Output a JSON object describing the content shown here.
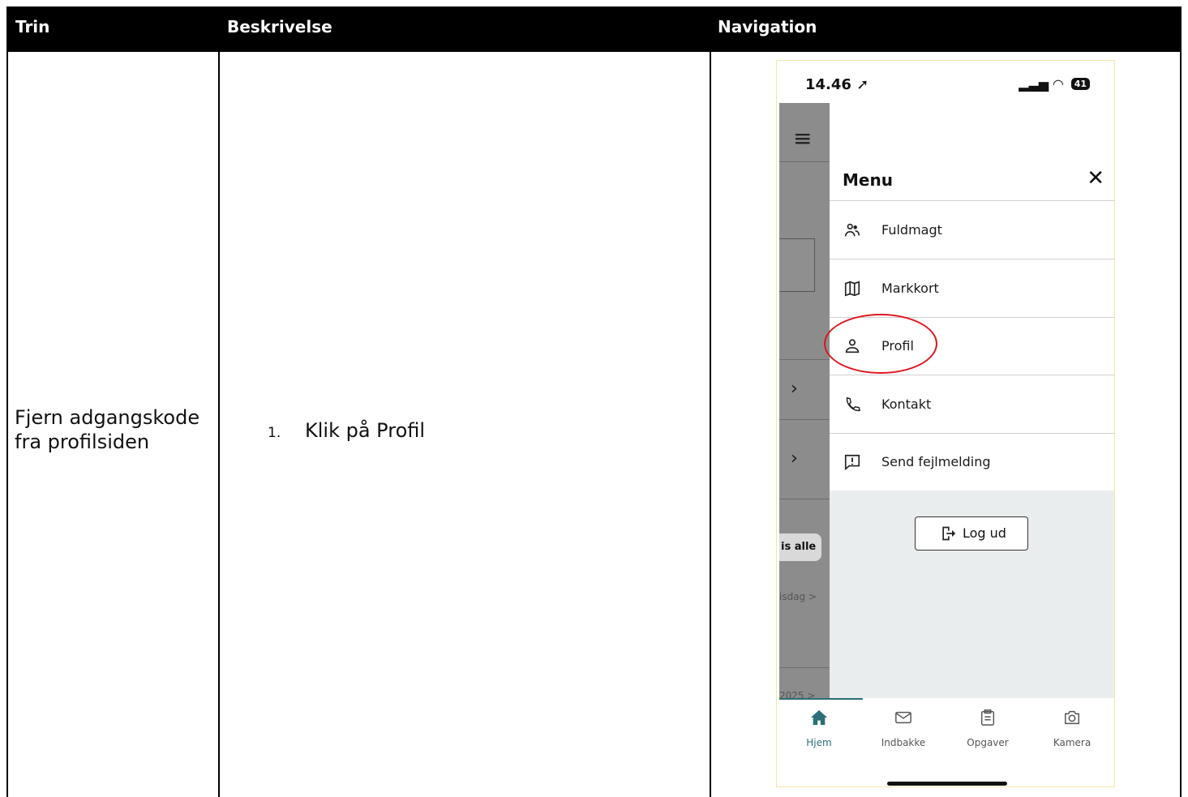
{
  "table": {
    "headers": {
      "trin": "Trin",
      "beskrivelse": "Beskrivelse",
      "navigation": "Navigation"
    },
    "row": {
      "trin": "Fjern adgangskode fra profilsiden",
      "step_number": "1.",
      "step_text": "Klik på Profil"
    }
  },
  "phone": {
    "status": {
      "time": "14.46",
      "battery": "41"
    },
    "backdrop": {
      "pill": "is alle",
      "row1": "isdag >",
      "row2": "2025 >"
    },
    "menu": {
      "title": "Menu",
      "items": [
        {
          "label": "Fuldmagt",
          "icon": "people-icon"
        },
        {
          "label": "Markkort",
          "icon": "map-icon"
        },
        {
          "label": "Profil",
          "icon": "person-icon"
        },
        {
          "label": "Kontakt",
          "icon": "phone-icon"
        },
        {
          "label": "Send fejlmelding",
          "icon": "report-icon"
        }
      ],
      "logout": "Log ud"
    },
    "tabs": [
      {
        "label": "Hjem",
        "icon": "home-icon",
        "active": true
      },
      {
        "label": "Indbakke",
        "icon": "mail-icon"
      },
      {
        "label": "Opgaver",
        "icon": "clipboard-icon"
      },
      {
        "label": "Kamera",
        "icon": "camera-icon"
      }
    ],
    "colors": {
      "accent": "#2b6f78",
      "highlight": "#e0141c",
      "backdrop": "#8c8c8c"
    }
  }
}
